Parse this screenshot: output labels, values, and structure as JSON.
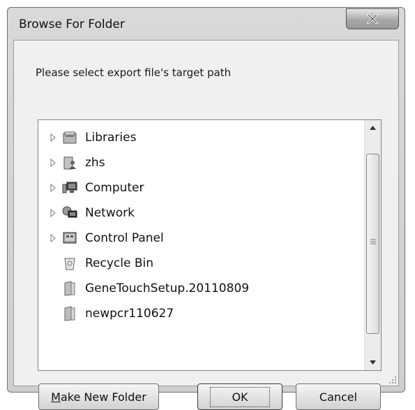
{
  "window": {
    "title": "Browse For Folder",
    "close_label": "X"
  },
  "prompt": "Please select export file's target path",
  "tree": {
    "items": [
      {
        "label": "Libraries",
        "icon": "libraries-icon",
        "expandable": true
      },
      {
        "label": "zhs",
        "icon": "user-folder-icon",
        "expandable": true
      },
      {
        "label": "Computer",
        "icon": "computer-icon",
        "expandable": true
      },
      {
        "label": "Network",
        "icon": "network-icon",
        "expandable": true
      },
      {
        "label": "Control Panel",
        "icon": "control-panel-icon",
        "expandable": true
      },
      {
        "label": "Recycle Bin",
        "icon": "recycle-bin-icon",
        "expandable": false
      },
      {
        "label": "GeneTouchSetup.20110809",
        "icon": "folder-icon",
        "expandable": false
      },
      {
        "label": "newpcr110627",
        "icon": "folder-icon",
        "expandable": false
      }
    ]
  },
  "buttons": {
    "make_new_folder_underline": "M",
    "make_new_folder_rest": "ake New Folder",
    "ok": "OK",
    "cancel": "Cancel"
  }
}
